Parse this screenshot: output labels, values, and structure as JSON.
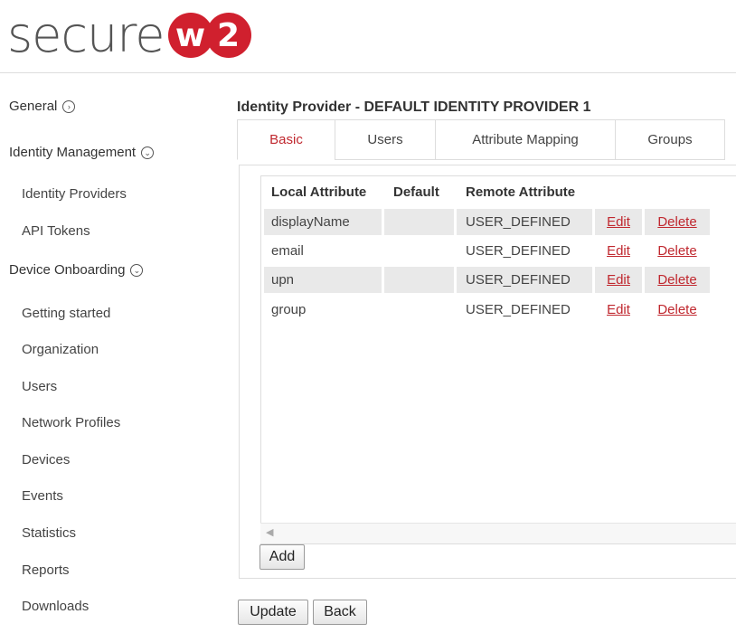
{
  "brand": {
    "wordmark": "secure",
    "badge_letter": "w",
    "badge_number": "2",
    "accent_color": "#d0202e"
  },
  "sidebar": {
    "general": {
      "label": "General",
      "icon": "chevron-right-circle-icon"
    },
    "identity_management": {
      "label": "Identity Management",
      "icon": "chevron-down-circle-icon",
      "items": [
        {
          "label": "Identity Providers"
        },
        {
          "label": "API Tokens"
        }
      ]
    },
    "device_onboarding": {
      "label": "Device Onboarding",
      "icon": "chevron-down-circle-icon",
      "items": [
        {
          "label": "Getting started"
        },
        {
          "label": "Organization"
        },
        {
          "label": "Users"
        },
        {
          "label": "Network Profiles"
        },
        {
          "label": "Devices"
        },
        {
          "label": "Events"
        },
        {
          "label": "Statistics"
        },
        {
          "label": "Reports"
        },
        {
          "label": "Downloads"
        }
      ]
    }
  },
  "main": {
    "title": "Identity Provider - DEFAULT IDENTITY PROVIDER 1",
    "tabs": [
      {
        "label": "Basic",
        "active": true
      },
      {
        "label": "Users",
        "active": false
      },
      {
        "label": "Attribute Mapping",
        "active": false
      },
      {
        "label": "Groups",
        "active": false
      }
    ],
    "table": {
      "headers": {
        "local": "Local Attribute",
        "default": "Default",
        "remote": "Remote Attribute"
      },
      "rows": [
        {
          "local": "displayName",
          "default": "",
          "remote": "USER_DEFINED",
          "edit": "Edit",
          "delete": "Delete"
        },
        {
          "local": "email",
          "default": "",
          "remote": "USER_DEFINED",
          "edit": "Edit",
          "delete": "Delete"
        },
        {
          "local": "upn",
          "default": "",
          "remote": "USER_DEFINED",
          "edit": "Edit",
          "delete": "Delete"
        },
        {
          "local": "group",
          "default": "",
          "remote": "USER_DEFINED",
          "edit": "Edit",
          "delete": "Delete"
        }
      ]
    },
    "add_label": "Add",
    "update_label": "Update",
    "back_label": "Back",
    "link_color": "#c0282f"
  }
}
